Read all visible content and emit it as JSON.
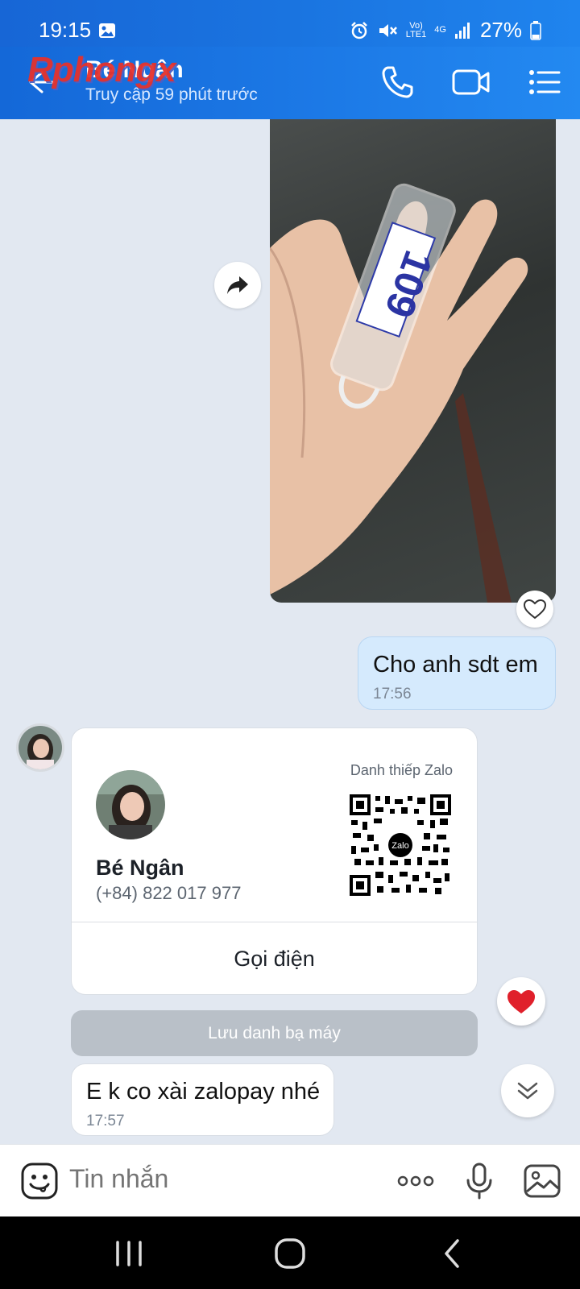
{
  "status_bar": {
    "time": "19:15",
    "battery": "27%",
    "network": "4G",
    "volte_top": "Vo)",
    "volte_bottom": "LTE1"
  },
  "header": {
    "title": "Bé Ngân",
    "subtitle": "Truy cập 59 phút trước",
    "watermark": "Rphongx"
  },
  "messages": {
    "sent": {
      "text": "Cho anh sdt em",
      "time": "17:56"
    },
    "contact_card": {
      "label": "Danh thiếp Zalo",
      "name": "Bé Ngân",
      "phone": "(+84) 822 017 977",
      "call_label": "Gọi điện",
      "save_label": "Lưu danh bạ máy",
      "qr_logo": "Zalo"
    },
    "received": {
      "text": "E k co xài zalopay nhé",
      "time": "17:57"
    }
  },
  "photo": {
    "tag_number": "109"
  },
  "input": {
    "placeholder": "Tin nhắn"
  },
  "colors": {
    "header": "#1c79e6",
    "sent_bubble": "#d5eafd",
    "background": "#e2e8f1",
    "heart": "#e0202b"
  }
}
